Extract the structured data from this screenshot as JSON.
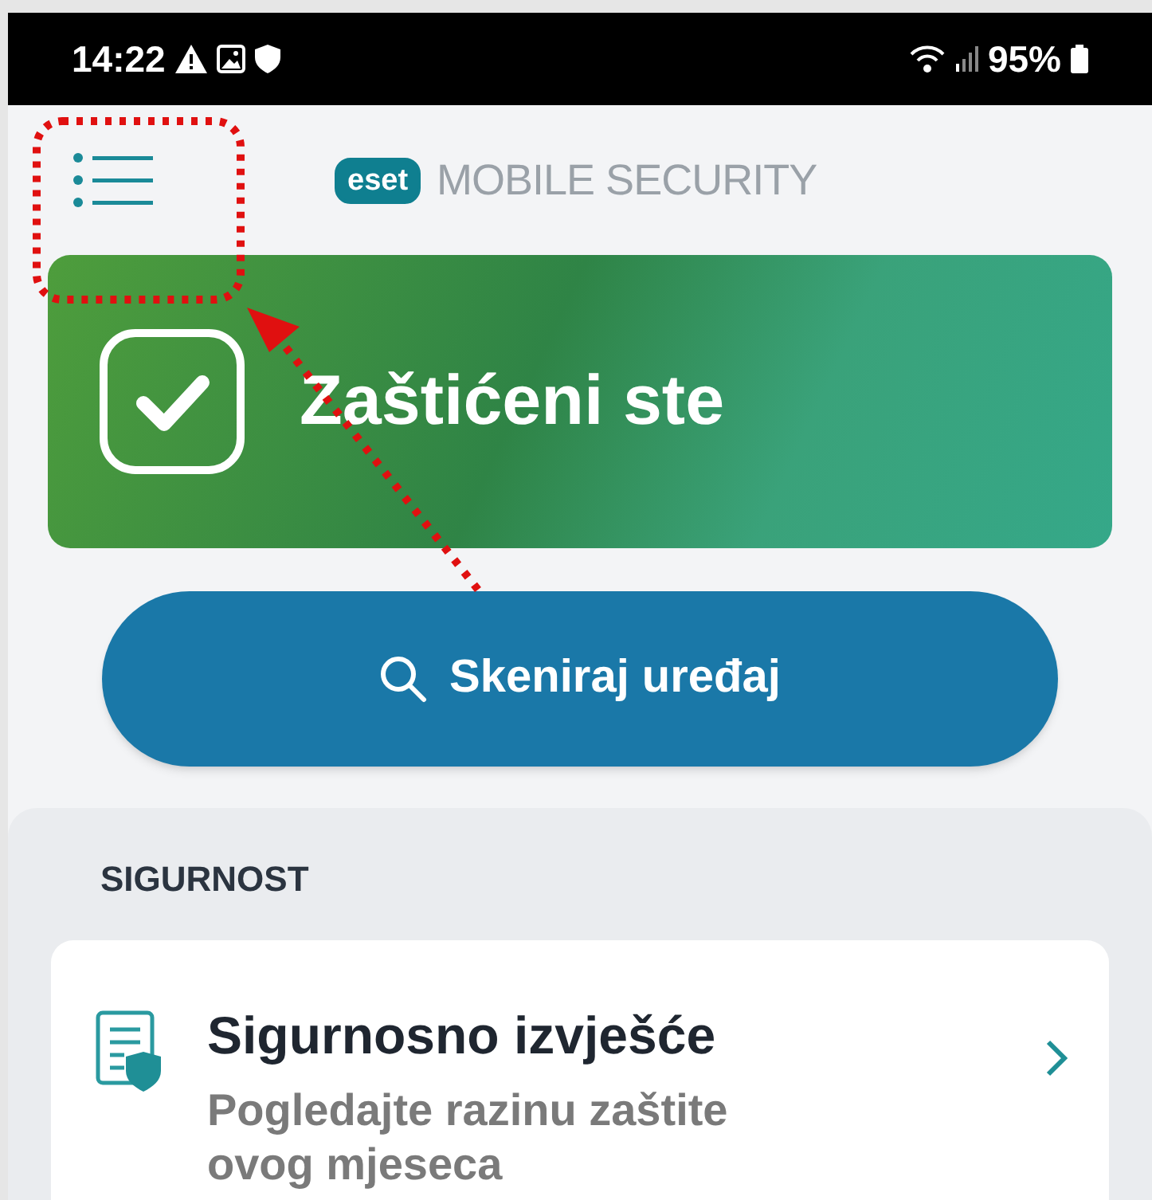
{
  "status_bar": {
    "time": "14:22",
    "battery": "95%"
  },
  "header": {
    "logo_mark": "eset",
    "app_name": "MOBILE SECURITY"
  },
  "status_card": {
    "title": "Zaštićeni ste",
    "protected": true
  },
  "scan_button": {
    "label": "Skeniraj uređaj"
  },
  "section": {
    "title": "SIGURNOST",
    "items": [
      {
        "title": "Sigurnosno izvješće",
        "description": "Pogledajte razinu zaštite ovog mjeseca"
      }
    ]
  },
  "annotation": {
    "highlight_box": true,
    "arrow": true
  }
}
